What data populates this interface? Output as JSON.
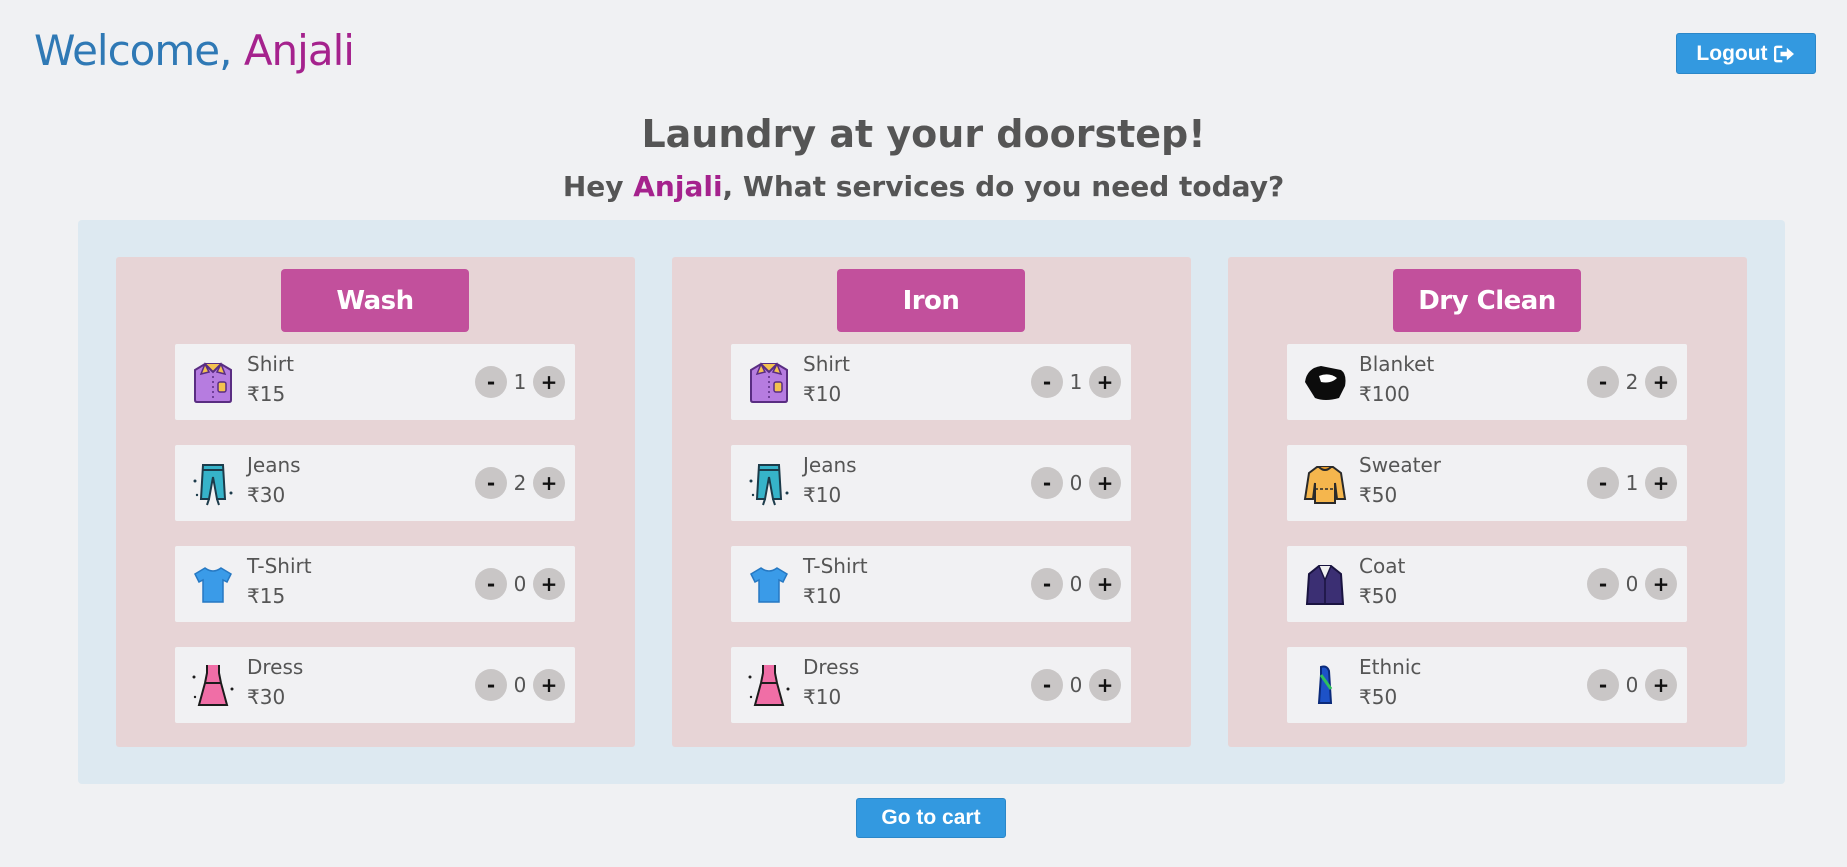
{
  "header": {
    "welcome_prefix": "Welcome,",
    "user_name": "Anjali",
    "logout_label": "Logout"
  },
  "hero": {
    "headline": "Laundry at your doorstep!",
    "greeting_prefix": "Hey ",
    "greeting_name": "Anjali",
    "greeting_suffix": ", What services do you need today?"
  },
  "services": [
    {
      "title": "Wash",
      "items": [
        {
          "name": "Shirt",
          "price": "₹15",
          "qty": "1",
          "icon": "shirt-icon"
        },
        {
          "name": "Jeans",
          "price": "₹30",
          "qty": "2",
          "icon": "jeans-icon"
        },
        {
          "name": "T-Shirt",
          "price": "₹15",
          "qty": "0",
          "icon": "tshirt-icon"
        },
        {
          "name": "Dress",
          "price": "₹30",
          "qty": "0",
          "icon": "dress-icon"
        }
      ]
    },
    {
      "title": "Iron",
      "items": [
        {
          "name": "Shirt",
          "price": "₹10",
          "qty": "1",
          "icon": "shirt-icon"
        },
        {
          "name": "Jeans",
          "price": "₹10",
          "qty": "0",
          "icon": "jeans-icon"
        },
        {
          "name": "T-Shirt",
          "price": "₹10",
          "qty": "0",
          "icon": "tshirt-icon"
        },
        {
          "name": "Dress",
          "price": "₹10",
          "qty": "0",
          "icon": "dress-icon"
        }
      ]
    },
    {
      "title": "Dry Clean",
      "items": [
        {
          "name": "Blanket",
          "price": "₹100",
          "qty": "2",
          "icon": "blanket-icon"
        },
        {
          "name": "Sweater",
          "price": "₹50",
          "qty": "1",
          "icon": "sweater-icon"
        },
        {
          "name": "Coat",
          "price": "₹50",
          "qty": "0",
          "icon": "coat-icon"
        },
        {
          "name": "Ethnic",
          "price": "₹50",
          "qty": "0",
          "icon": "ethnic-icon"
        }
      ]
    }
  ],
  "controls": {
    "minus": "-",
    "plus": "+"
  },
  "cart_label": "Go to cart",
  "colors": {
    "accent_blue": "#3399e0",
    "brand_pink": "#c2509c",
    "name_purple": "#a5228d",
    "welcome_blue": "#2f79b5"
  }
}
